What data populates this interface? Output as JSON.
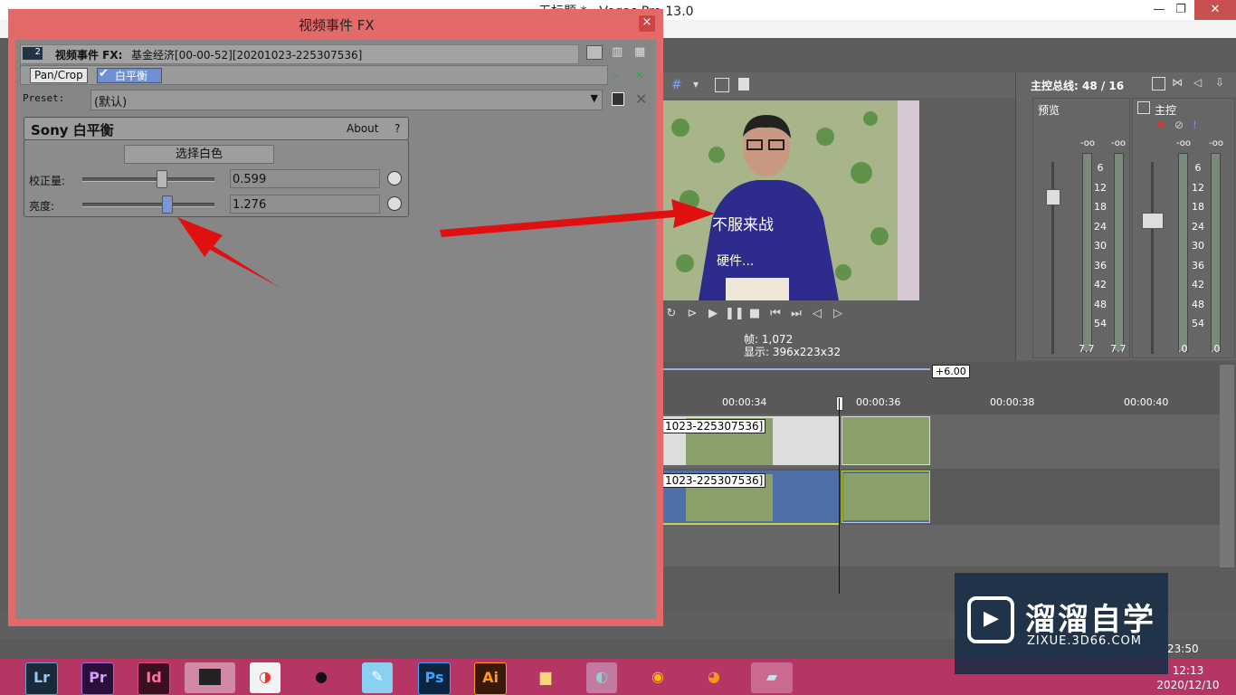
{
  "vegas": {
    "title": "无标题 * - Vegas Pro 13.0",
    "frame_label": "帧:",
    "frame_value": "1,072",
    "display_label": "显示:",
    "display_value": "396x223x32",
    "master_bus_label": "主控总线: 48 / 16",
    "preview_label": "预览",
    "master_label": "主控",
    "meter_top": "-oo",
    "meter_scale": [
      "6",
      "12",
      "18",
      "24",
      "30",
      "36",
      "42",
      "48",
      "54"
    ],
    "meter_bottom_left": "7.7",
    "meter_bottom_right": ".0",
    "rate_badge": "+6.00",
    "time_marks": [
      "00:00:34",
      "00:00:36",
      "00:00:38",
      "00:00:40"
    ],
    "clip1_label": "1023-225307536]",
    "clip2_label": "1023-225307536]",
    "status_time": "23:50",
    "video_text_line1": "不服来战",
    "video_text_line2": "硬件..."
  },
  "fx_dialog": {
    "title": "视频事件 FX",
    "close_glyph": "×",
    "header_badge": "2",
    "header_bold": "视频事件 FX:",
    "header_text": "基金经济[00-00-52][20201023-225307536]",
    "chain": [
      "Pan/Crop",
      "白平衡"
    ],
    "preset_label": "Preset:",
    "preset_value": "(默认)",
    "plugin_name": "Sony 白平衡",
    "about": "About",
    "help": "?",
    "select_white_button": "选择白色",
    "params": [
      {
        "label": "校正量:",
        "value": "0.599",
        "fraction": 0.599
      },
      {
        "label": "亮度:",
        "value": "1.276",
        "fraction": 0.638
      }
    ]
  },
  "taskbar": {
    "apps": [
      "Lr",
      "Pr",
      "Id",
      "",
      "",
      "",
      "",
      "Ps",
      "Ai",
      "",
      "",
      "",
      "",
      ""
    ],
    "time": "12:13",
    "date": "2020/12/10"
  },
  "watermark": {
    "title": "溜溜自学",
    "url": "ZIXUE.3D66.COM"
  },
  "colors": {
    "dialog_border": "#e46a6a",
    "taskbar": "#b53565",
    "arrow": "#e01010",
    "clip_selected_border": "#c6d93a"
  }
}
